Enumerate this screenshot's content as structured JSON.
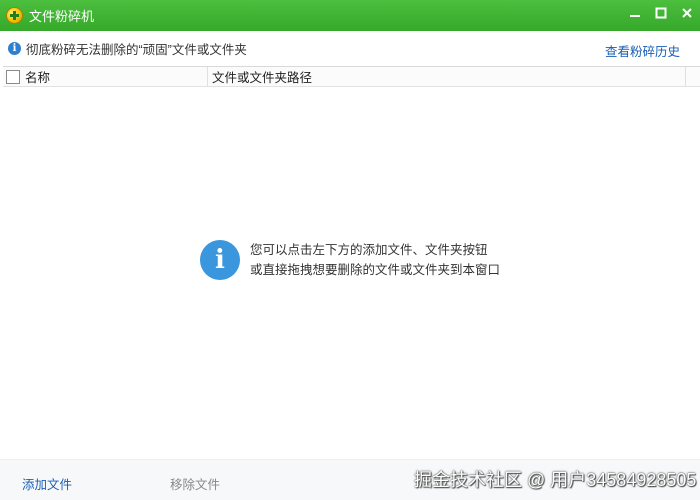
{
  "window": {
    "title": "文件粉碎机",
    "controls": {
      "minimize": "–",
      "maximize": "□",
      "close": "✕"
    }
  },
  "infobar": {
    "icon_glyph": "i",
    "text": "彻底粉碎无法删除的“顽固”文件或文件夹",
    "history_link": "查看粉碎历史"
  },
  "list": {
    "columns": {
      "name": "名称",
      "path": "文件或文件夹路径"
    },
    "rows": []
  },
  "empty_state": {
    "icon_glyph": "i",
    "line1": "您可以点击左下方的添加文件、文件夹按钮",
    "line2": "或直接拖拽想要删除的文件或文件夹到本窗口"
  },
  "bottombar": {
    "add_file": "添加文件",
    "remove_file": "移除文件"
  },
  "watermark": "掘金技术社区 @ 用户3458492​8505"
}
